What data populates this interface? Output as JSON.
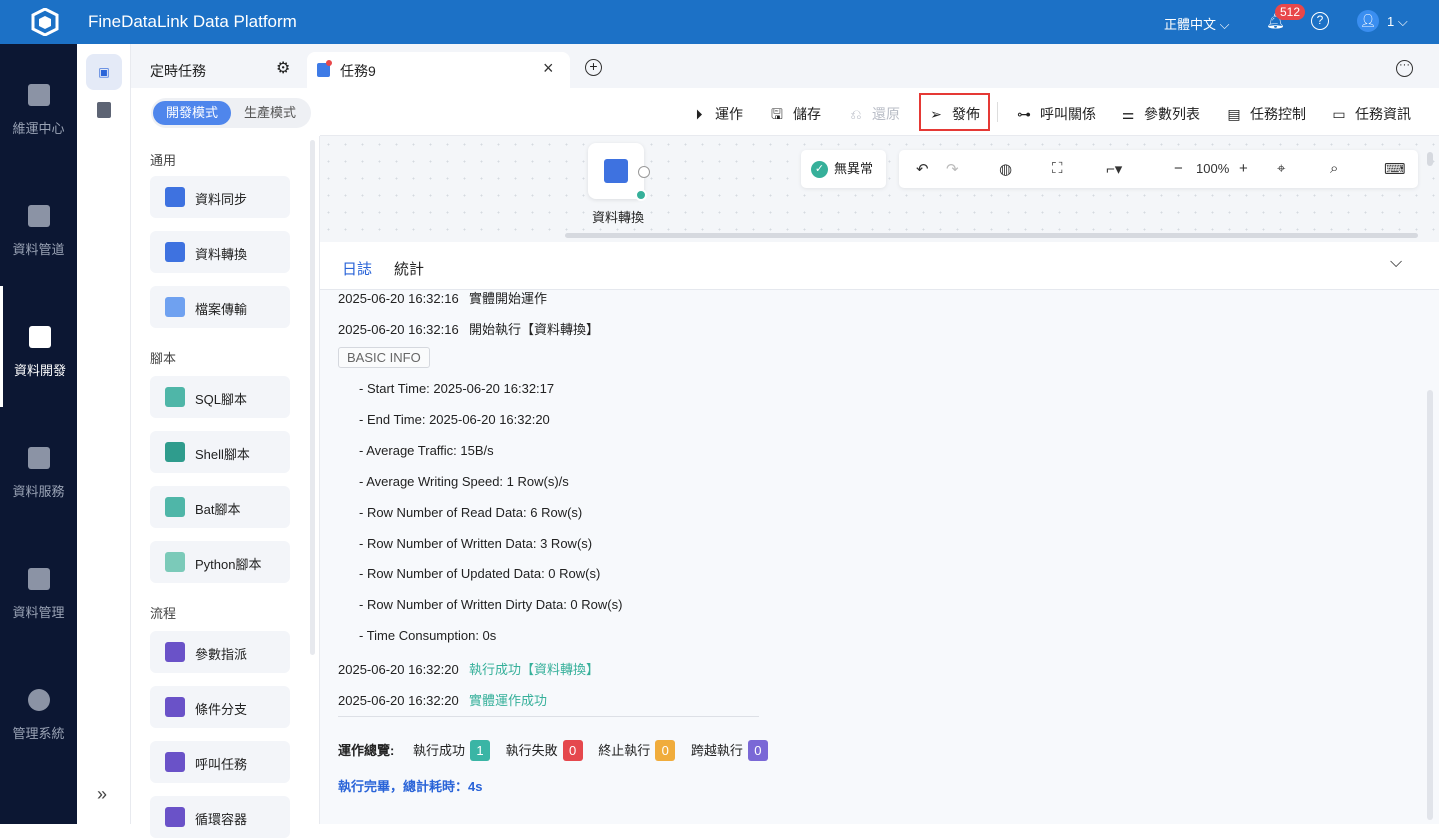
{
  "header": {
    "title": "FineDataLink Data Platform",
    "language": "正體中文",
    "notification_count": "512",
    "user": "1"
  },
  "nav": [
    {
      "label": "維運中心"
    },
    {
      "label": "資料管道"
    },
    {
      "label": "資料開發"
    },
    {
      "label": "資料服務"
    },
    {
      "label": "資料管理"
    },
    {
      "label": "管理系統"
    }
  ],
  "tabs": {
    "scheduled": "定時任務",
    "active": "任務9"
  },
  "modes": {
    "dev": "開發模式",
    "prod": "生產模式"
  },
  "toolbar": {
    "run": "運作",
    "save": "儲存",
    "restore": "還原",
    "publish": "發佈",
    "call_relation": "呼叫關係",
    "param_list": "參數列表",
    "task_control": "任務控制",
    "task_info": "任務資訊"
  },
  "components": {
    "sections": [
      "通用",
      "腳本",
      "流程"
    ],
    "general": [
      "資料同步",
      "資料轉換",
      "檔案傳輸"
    ],
    "script": [
      "SQL腳本",
      "Shell腳本",
      "Bat腳本",
      "Python腳本"
    ],
    "flow": [
      "參數指派",
      "條件分支",
      "呼叫任務",
      "循環容器"
    ]
  },
  "canvas": {
    "node_label": "資料轉換",
    "status": "無異常",
    "zoom": "100%"
  },
  "log": {
    "tabs": [
      "日誌",
      "統計"
    ],
    "entries": [
      {
        "time": "2025-06-20 16:32:16",
        "msg": "實體開始運作"
      },
      {
        "time": "2025-06-20 16:32:16",
        "msg": "開始執行【資料轉換】"
      }
    ],
    "basic_info": "BASIC INFO",
    "info": [
      "- Start Time: 2025-06-20 16:32:17",
      "- End Time: 2025-06-20 16:32:20",
      "- Average Traffic: 15B/s",
      "- Average Writing Speed: 1 Row(s)/s",
      "- Row Number of Read Data: 6 Row(s)",
      "- Row Number of Written Data: 3 Row(s)",
      "- Row Number of Updated Data: 0 Row(s)",
      "- Row Number of Written Dirty Data: 0 Row(s)",
      "- Time Consumption: 0s"
    ],
    "results": [
      {
        "time": "2025-06-20 16:32:20",
        "msg": "執行成功【資料轉換】"
      },
      {
        "time": "2025-06-20 16:32:20",
        "msg": "實體運作成功"
      }
    ],
    "summary": {
      "label": "運作總覽:",
      "success_label": "執行成功",
      "success": "1",
      "fail_label": "執行失敗",
      "fail": "0",
      "stop_label": "終止執行",
      "stop": "0",
      "skip_label": "跨越執行",
      "skip": "0"
    },
    "done": "執行完畢，總計耗時：4s"
  },
  "colors": {
    "brand": "#1c71c6",
    "success": "#3ab5a5",
    "fail": "#e5484d",
    "stop": "#f0ac3c",
    "skip": "#7a68d6"
  }
}
